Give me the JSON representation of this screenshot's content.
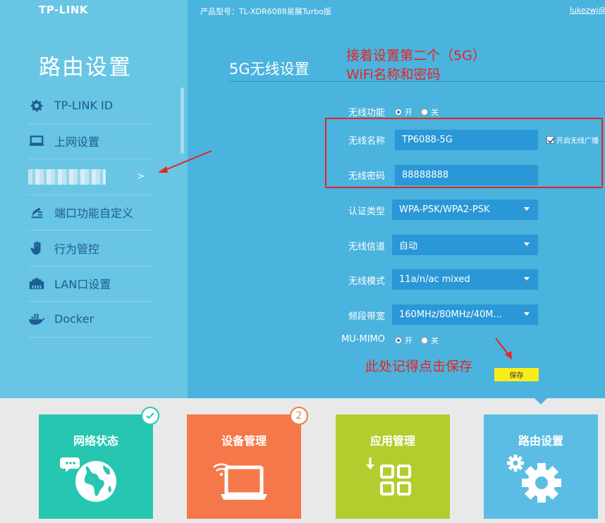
{
  "header": {
    "logo": "TP-LINK",
    "product_model": "产品型号：TL-XDR6088易展Turbo版",
    "user": "lukezwj@"
  },
  "sidebar": {
    "title": "路由设置",
    "items": [
      {
        "label": "TP-LINK ID",
        "icon": "gear-icon"
      },
      {
        "label": "上网设置",
        "icon": "laptop-icon"
      },
      {
        "label": "",
        "icon": "blurred",
        "chevron": ">"
      },
      {
        "label": "端口功能自定义",
        "icon": "pen-icon"
      },
      {
        "label": "行为管控",
        "icon": "hand-icon"
      },
      {
        "label": "LAN口设置",
        "icon": "lan-port-icon"
      },
      {
        "label": "Docker",
        "icon": "docker-icon"
      }
    ]
  },
  "main": {
    "section_title": "5G无线设置",
    "annotation_top_line1": "接着设置第二个（5G）",
    "annotation_top_line2": "WiFi名称和密码",
    "annotation_save": "此处记得点击保存",
    "wireless_function": {
      "label": "无线功能",
      "on": "开",
      "off": "关",
      "selected": "on"
    },
    "ssid": {
      "label": "无线名称",
      "value": "TP6088-5G"
    },
    "broadcast": {
      "label": "开启无线广播",
      "checked": true
    },
    "password": {
      "label": "无线密码",
      "value": "88888888"
    },
    "auth_type": {
      "label": "认证类型",
      "value": "WPA-PSK/WPA2-PSK"
    },
    "channel": {
      "label": "无线信道",
      "value": "自动"
    },
    "mode": {
      "label": "无线模式",
      "value": "11a/n/ac mixed"
    },
    "bandwidth": {
      "label": "频段带宽",
      "value": "160MHz/80MHz/40M..."
    },
    "mu_mimo": {
      "label": "MU-MIMO",
      "on": "开",
      "off": "关",
      "selected": "on"
    },
    "save_label": "保存"
  },
  "tiles": [
    {
      "label": "网络状态",
      "color": "#27c6b0",
      "badge": "check"
    },
    {
      "label": "设备管理",
      "color": "#f5784a",
      "badge": "2"
    },
    {
      "label": "应用管理",
      "color": "#b3cd2e"
    },
    {
      "label": "路由设置",
      "color": "#5bbde3"
    }
  ],
  "colors": {
    "sidebar_bg": "#68c5e4",
    "main_bg": "#4ab3de",
    "field_bg": "#2a98d6",
    "annotation": "#e8231f",
    "save_button": "#f7ec1c",
    "nav_text": "#1e5c91"
  }
}
